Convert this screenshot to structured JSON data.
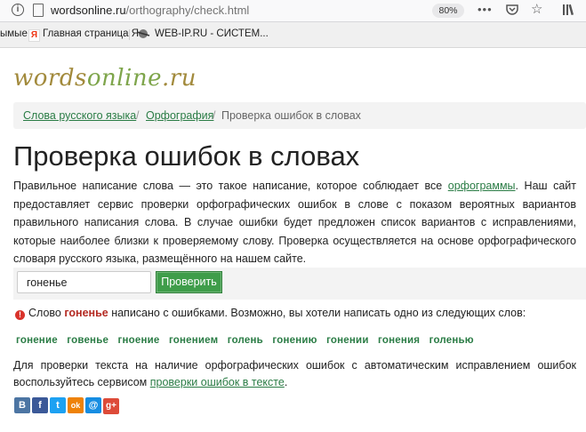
{
  "browser": {
    "url_domain": "wordsonline.ru",
    "url_path": "/orthography/check.html",
    "zoom": "80%",
    "bookmarks": [
      "ымые",
      "Главная страница Я...",
      "WEB-IP.RU - СИСТЕМ..."
    ]
  },
  "site": {
    "logo_words": "words",
    "logo_online": "online",
    "logo_ru": ".ru"
  },
  "breadcrumb": {
    "item1": "Слова русского языка",
    "item2": "Орфография",
    "current": "Проверка ошибок в словах",
    "sep": "/"
  },
  "page": {
    "title": "Проверка ошибок в словах",
    "intro_before": "Правильное написание слова — это такое написание, которое соблюдает все ",
    "intro_link": "орфограммы",
    "intro_after": ". Наш сайт предоставляет сервис проверки орфографических ошибок в слове с показом вероятных вариантов правильного написания слова. В случае ошибки будет предложен список вариантов с исправлениями, которые наиболее близки к проверяемому слову. Проверка осуществляется на основе орфографического словаря русского языка, размещённого на нашем сайте."
  },
  "form": {
    "input_value": "гоненье",
    "button_label": "Проверить"
  },
  "result": {
    "icon": "exclamation-circle-icon",
    "prefix": "Слово ",
    "word": "гоненье",
    "suffix": " написано с ошибками. Возможно, вы хотели написать одно из следующих слов:"
  },
  "suggestions": [
    "гонение",
    "говенье",
    "гноение",
    "гонением",
    "голень",
    "гонению",
    "гонении",
    "гонения",
    "голенью"
  ],
  "footer": {
    "text_before": "Для проверки текста на наличие орфографических ошибок с автоматическим исправлением ошибок воспользуйтесь сервисом ",
    "link": "проверки ошибок в тексте",
    "text_after": "."
  },
  "socials": {
    "vk": "В",
    "facebook": "f",
    "twitter": "t",
    "odnoklassniki": "ok",
    "mail": "@",
    "gplus": "g+"
  },
  "colors": {
    "link_green": "#2a7c45",
    "button_green": "#3f9d4a",
    "error_red": "#b42a22"
  }
}
